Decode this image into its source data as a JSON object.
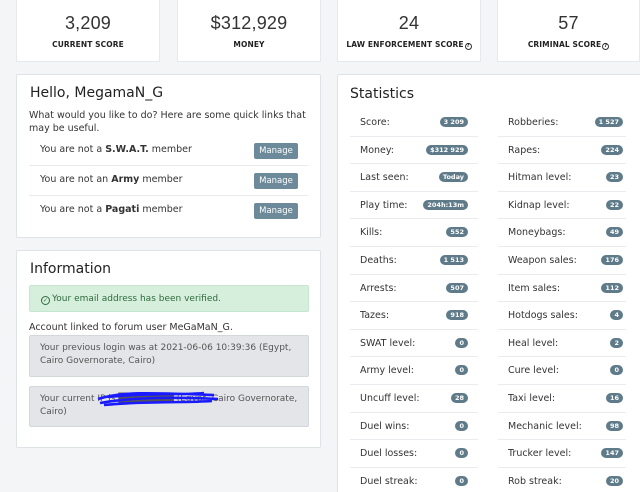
{
  "top_stats": [
    {
      "value": "3,209",
      "label": "CURRENT SCORE",
      "help": false
    },
    {
      "value": "$312,929",
      "label": "MONEY",
      "help": false
    },
    {
      "value": "24",
      "label": "LAW ENFORCEMENT SCORE",
      "help": true
    },
    {
      "value": "57",
      "label": "CRIMINAL SCORE",
      "help": true
    }
  ],
  "help_icon": "?",
  "welcome": {
    "greeting": "Hello, MegamaN_G",
    "intro": "What would you like to do? Here are some quick links that may be useful.",
    "rows": [
      {
        "prefix": "You are not a ",
        "group": "S.W.A.T.",
        "suffix": " member",
        "button": "Manage"
      },
      {
        "prefix": "You are not an ",
        "group": "Army",
        "suffix": " member",
        "button": "Manage"
      },
      {
        "prefix": "You are not a ",
        "group": "Pagati",
        "suffix": " member",
        "button": "Manage"
      }
    ]
  },
  "information": {
    "title": "Information",
    "verified_icon": "check-circle-icon",
    "verified": "Your email address has been verified.",
    "forum": "Account linked to forum user MeGaMaN_G.",
    "previous_login": "Your previous login was at 2021-06-06 10:39:36 (Egypt, Cairo Governorate, Cairo)",
    "current_ip": "Your current IP is ████████ (Egypt, Cairo Governorate, Cairo)"
  },
  "statistics": {
    "title": "Statistics",
    "left": [
      {
        "label": "Score:",
        "value": "3 209"
      },
      {
        "label": "Money:",
        "value": "$312 929"
      },
      {
        "label": "Last seen:",
        "value": "Today"
      },
      {
        "label": "Play time:",
        "value": "204h:13m"
      },
      {
        "label": "Kills:",
        "value": "552"
      },
      {
        "label": "Deaths:",
        "value": "1 513"
      },
      {
        "label": "Arrests:",
        "value": "507"
      },
      {
        "label": "Tazes:",
        "value": "918"
      },
      {
        "label": "SWAT level:",
        "value": "0"
      },
      {
        "label": "Army level:",
        "value": "0"
      },
      {
        "label": "Uncuff level:",
        "value": "28"
      },
      {
        "label": "Duel wins:",
        "value": "0"
      },
      {
        "label": "Duel losses:",
        "value": "0"
      },
      {
        "label": "Duel streak:",
        "value": "0"
      }
    ],
    "right": [
      {
        "label": "Robberies:",
        "value": "1 527"
      },
      {
        "label": "Rapes:",
        "value": "224"
      },
      {
        "label": "Hitman level:",
        "value": "23"
      },
      {
        "label": "Kidnap level:",
        "value": "22"
      },
      {
        "label": "Moneybags:",
        "value": "49"
      },
      {
        "label": "Weapon sales:",
        "value": "176"
      },
      {
        "label": "Item sales:",
        "value": "112"
      },
      {
        "label": "Hotdogs sales:",
        "value": "4"
      },
      {
        "label": "Heal level:",
        "value": "2"
      },
      {
        "label": "Cure level:",
        "value": "0"
      },
      {
        "label": "Taxi level:",
        "value": "16"
      },
      {
        "label": "Mechanic level:",
        "value": "98"
      },
      {
        "label": "Trucker level:",
        "value": "147"
      },
      {
        "label": "Rob streak:",
        "value": "20"
      }
    ]
  }
}
